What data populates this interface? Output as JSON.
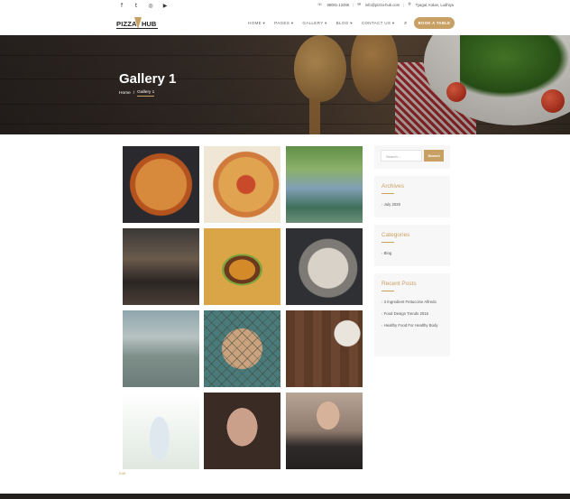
{
  "topbar": {
    "social_icons": [
      "facebook-icon",
      "twitter-icon",
      "instagram-icon",
      "youtube-icon"
    ],
    "social_glyphs": [
      "f",
      "t",
      "◎",
      "▶"
    ],
    "phone": "98081-13456",
    "email": "info@pizza-hub.com",
    "address": "Tyagal, Kalan, Ludhiya"
  },
  "header": {
    "logo_left": "PIZZA",
    "logo_right": "HUB",
    "menu": [
      "HOME ▾",
      "PAGES ▾",
      "GALLERY ▾",
      "BLOG ▾",
      "CONTACT US ▾"
    ],
    "book_label": "BOOK A TABLE"
  },
  "hero": {
    "title": "Gallery 1",
    "breadcrumb_home": "Home",
    "breadcrumb_sep": "/",
    "breadcrumb_current": "Gallery 1"
  },
  "gallery": {
    "images": [
      {
        "name": "gallery-image-pizza"
      },
      {
        "name": "gallery-image-flatbread"
      },
      {
        "name": "gallery-image-cafe-table"
      },
      {
        "name": "gallery-image-barista"
      },
      {
        "name": "gallery-image-burger"
      },
      {
        "name": "gallery-image-oysters"
      },
      {
        "name": "gallery-image-girl-beach"
      },
      {
        "name": "gallery-image-child-fence"
      },
      {
        "name": "gallery-image-wood-plate"
      },
      {
        "name": "gallery-image-man-shirt"
      },
      {
        "name": "gallery-image-bearded-man"
      },
      {
        "name": "gallery-image-man-glasses"
      }
    ],
    "footnote": "Edit"
  },
  "sidebar": {
    "search_placeholder": "Search ...",
    "search_button": "Search",
    "archives_title": "Archives",
    "archives": [
      "July 2020"
    ],
    "categories_title": "Categories",
    "categories": [
      "Blog"
    ],
    "recent_title": "Recent Posts",
    "recent": [
      "3 Ingredient Fettuccine Alfredo",
      "Food Design Trends 2016",
      "Healthy Food For Healthy Body"
    ]
  },
  "colors": {
    "accent": "#c8a063",
    "dark": "#231f1d"
  }
}
